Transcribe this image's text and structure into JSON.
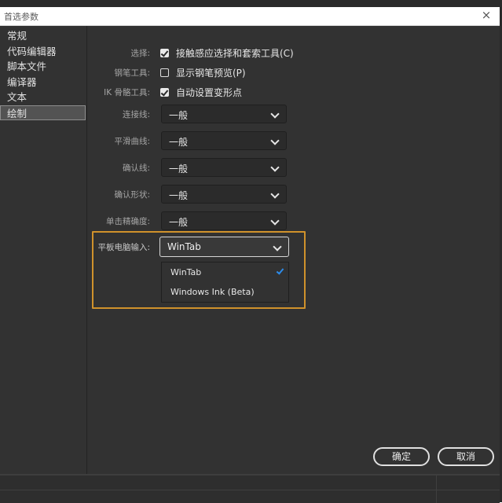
{
  "window": {
    "title": "首选参数",
    "close_glyph": "×"
  },
  "sidebar": {
    "items": [
      {
        "label": "常规",
        "selected": false
      },
      {
        "label": "代码编辑器",
        "selected": false
      },
      {
        "label": "脚本文件",
        "selected": false
      },
      {
        "label": "编译器",
        "selected": false
      },
      {
        "label": "文本",
        "selected": false
      },
      {
        "label": "绘制",
        "selected": true
      }
    ]
  },
  "settings": {
    "selection": {
      "label": "选择:",
      "text": "接触感应选择和套索工具(C)",
      "checked": true
    },
    "pen_tool": {
      "label": "钢笔工具:",
      "text": "显示钢笔预览(P)",
      "checked": false
    },
    "ik_bone": {
      "label": "IK 骨骼工具:",
      "text": "自动设置变形点",
      "checked": true
    },
    "connect_lines": {
      "label": "连接线:",
      "value": "一般"
    },
    "smooth_curves": {
      "label": "平滑曲线:",
      "value": "一般"
    },
    "recognize_lines": {
      "label": "确认线:",
      "value": "一般"
    },
    "recognize_shapes": {
      "label": "确认形状:",
      "value": "一般"
    },
    "click_accuracy": {
      "label": "单击精确度:",
      "value": "一般"
    },
    "tablet_input": {
      "label": "平板电脑输入:",
      "value": "WinTab",
      "options": [
        {
          "label": "WinTab",
          "selected": true
        },
        {
          "label": "Windows Ink (Beta)",
          "selected": false
        }
      ]
    }
  },
  "buttons": {
    "ok": "确定",
    "cancel": "取消"
  },
  "colors": {
    "panel_bg": "#323232",
    "highlight_border": "#d0922b",
    "checkmark_accent": "#2d8ceb"
  }
}
